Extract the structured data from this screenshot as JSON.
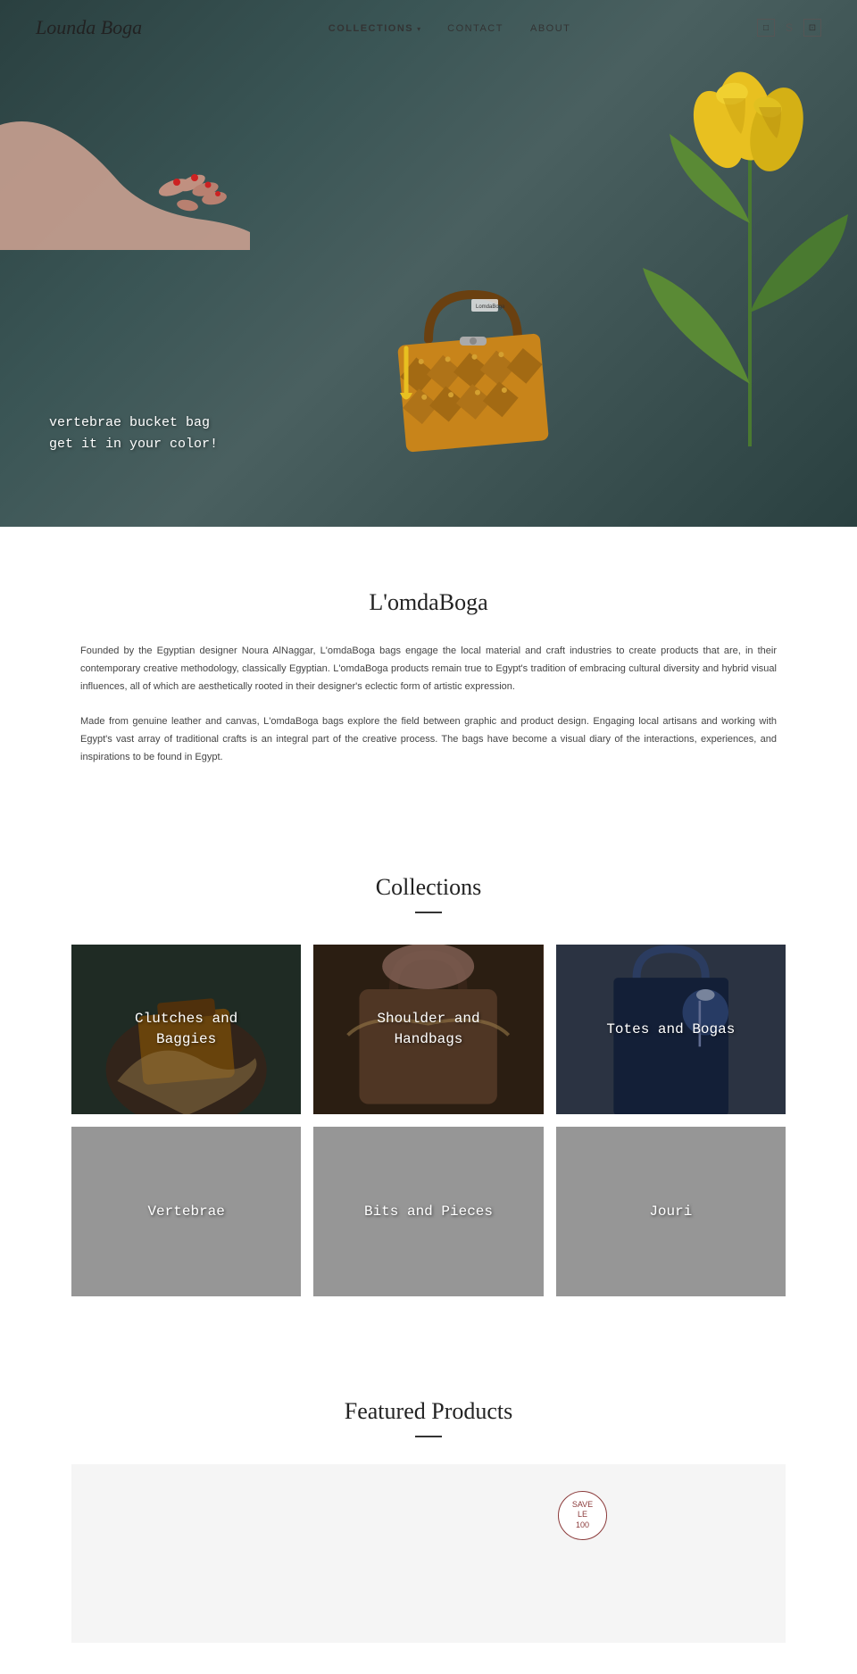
{
  "nav": {
    "logo": "Lounda Boga",
    "links": [
      {
        "label": "COLLECTIONS",
        "active": true,
        "hasArrow": true
      },
      {
        "label": "CONTACT",
        "active": false,
        "hasArrow": false
      },
      {
        "label": "ABOUT",
        "active": false,
        "hasArrow": false
      }
    ],
    "icons": [
      "□",
      "S",
      "⊡"
    ]
  },
  "hero": {
    "tagline_line1": "vertebrae bucket bag",
    "tagline_line2": "get it in your color!"
  },
  "about": {
    "title": "L'omdaBoga",
    "paragraph1": "Founded by the Egyptian designer Noura AlNaggar, L'omdaBoga bags engage the local material and craft industries to create products that are, in their contemporary creative methodology, classically Egyptian. L'omdaBoga products remain true to Egypt's tradition of embracing cultural diversity and hybrid visual influences, all of which are aesthetically rooted in their designer's eclectic form of artistic expression.",
    "paragraph2": "Made from genuine leather and canvas, L'omdaBoga bags explore the field between graphic and product design. Engaging local artisans and working with Egypt's vast array of traditional crafts is an integral part of the creative process. The bags have become a visual diary of the interactions, experiences, and inspirations to be found in Egypt."
  },
  "collections": {
    "title": "Collections",
    "items": [
      {
        "label": "Clutches and\nBaggies",
        "bg": "dark-teal"
      },
      {
        "label": "Shoulder and\nHandbags",
        "bg": "warm-brown"
      },
      {
        "label": "Totes and Bogas",
        "bg": "blue-gray"
      },
      {
        "label": "Vertebrae",
        "bg": "light-gray"
      },
      {
        "label": "Bits and Pieces",
        "bg": "light-gray"
      },
      {
        "label": "Jouri",
        "bg": "light-gray"
      }
    ]
  },
  "featured": {
    "title": "Featured Products",
    "badge": {
      "line1": "SAVE",
      "line2": "LE",
      "line3": "100"
    }
  }
}
